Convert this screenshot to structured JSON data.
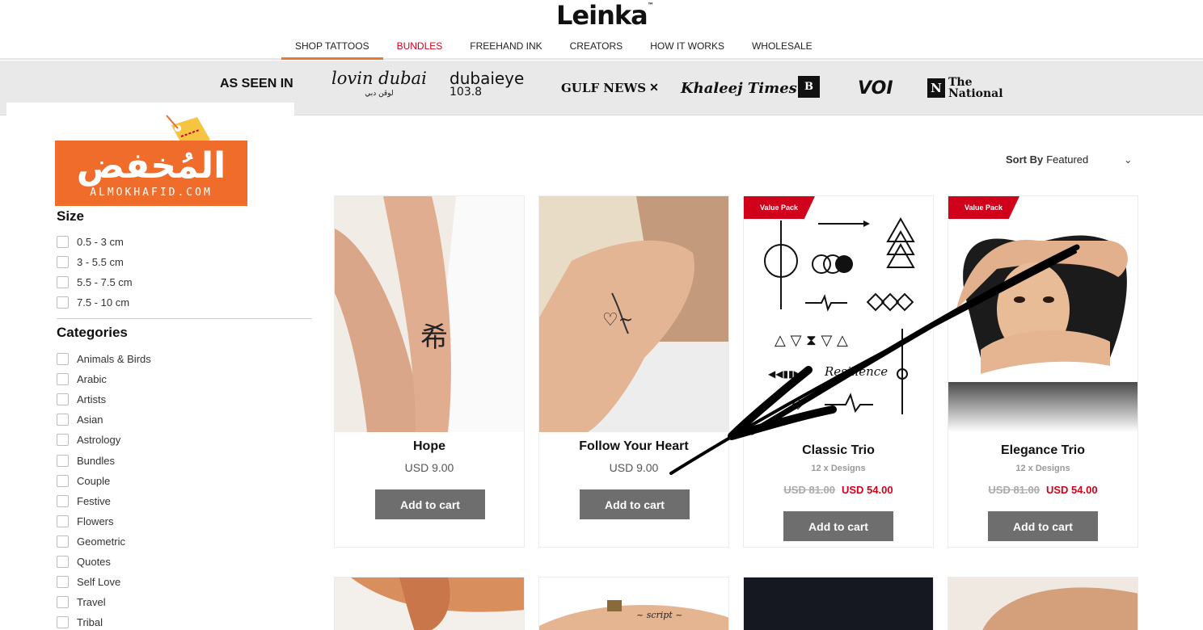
{
  "header": {
    "logo": "Leinka",
    "logo_tm": "™",
    "nav": [
      {
        "label": "SHOP TATTOOS"
      },
      {
        "label": "BUNDLES"
      },
      {
        "label": "FREEHAND INK"
      },
      {
        "label": "CREATORS"
      },
      {
        "label": "HOW IT WORKS"
      },
      {
        "label": "WHOLESALE"
      }
    ]
  },
  "press": {
    "title": "AS SEEN IN",
    "lovin": "lovin dubai",
    "lovin_ar": "لوڤن دبي",
    "dubaieye": "dubaieye",
    "dubaieye_freq": "103.8",
    "gulfnews": "GULF NEWS",
    "khaleej": "Khaleej Times",
    "b": "B",
    "voi": "VOI",
    "national_mark": "N",
    "national": "The National"
  },
  "watermark": {
    "arabic": "المُخفض",
    "latin": "ALMOKHAFID.COM"
  },
  "sidebar": {
    "size_title": "Size",
    "sizes": [
      "0.5 - 3 cm",
      "3 - 5.5 cm",
      "5.5 - 7.5 cm",
      "7.5 - 10 cm"
    ],
    "categories_title": "Categories",
    "categories": [
      "Animals & Birds",
      "Arabic",
      "Artists",
      "Asian",
      "Astrology",
      "Bundles",
      "Couple",
      "Festive",
      "Flowers",
      "Geometric",
      "Quotes",
      "Self Love",
      "Travel",
      "Tribal"
    ]
  },
  "sort": {
    "label": "Sort By",
    "value": "Featured"
  },
  "products": [
    {
      "title": "Hope",
      "price": "USD 9.00",
      "cta": "Add to cart"
    },
    {
      "title": "Follow Your Heart",
      "price": "USD 9.00",
      "cta": "Add to cart"
    },
    {
      "badge": "Value Pack",
      "title": "Classic Trio",
      "designs": "12 x Designs",
      "old_price": "USD 81.00",
      "new_price": "USD 54.00",
      "cta": "Add to cart"
    },
    {
      "badge": "Value Pack",
      "title": "Elegance Trio",
      "designs": "12 x Designs",
      "old_price": "USD 81.00",
      "new_price": "USD 54.00",
      "cta": "Add to cart"
    }
  ],
  "colors": {
    "accent": "#e87a2d",
    "sale": "#d0021b",
    "button": "#6e6e6e",
    "watermark": "#ef6c2b"
  }
}
